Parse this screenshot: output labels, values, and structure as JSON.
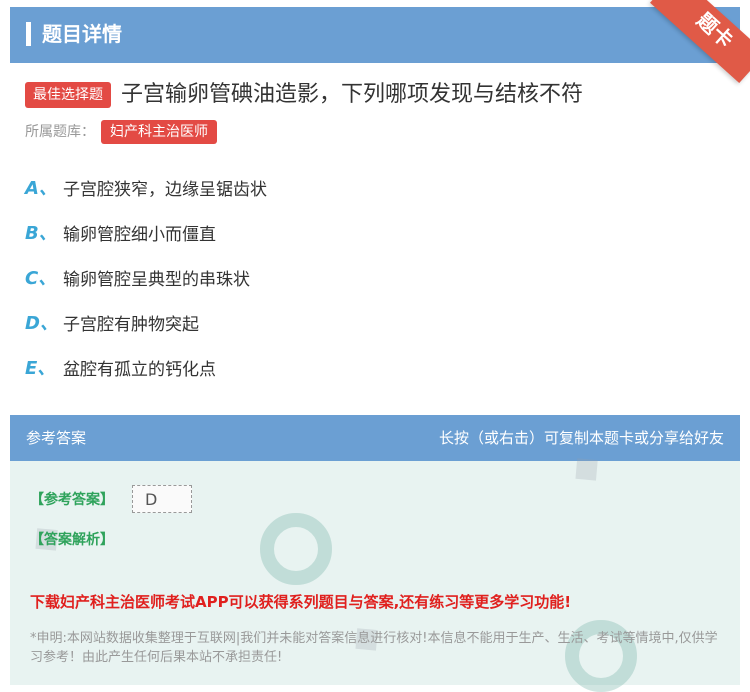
{
  "header": {
    "title": "题目详情"
  },
  "ribbon": {
    "label": "题卡",
    "color": "#e05a47"
  },
  "question": {
    "badge": "最佳选择题",
    "text": "子宫输卵管碘油造影，下列哪项发现与结核不符",
    "bank_label": "所属题库：",
    "bank_tag": "妇产科主治医师"
  },
  "options": [
    {
      "letter": "A、",
      "text": "子宫腔狭窄，边缘呈锯齿状"
    },
    {
      "letter": "B、",
      "text": "输卵管腔细小而僵直"
    },
    {
      "letter": "C、",
      "text": "输卵管腔呈典型的串珠状"
    },
    {
      "letter": "D、",
      "text": "子宫腔有肿物突起"
    },
    {
      "letter": "E、",
      "text": "盆腔有孤立的钙化点"
    }
  ],
  "answer": {
    "header_left": "参考答案",
    "header_right": "长按（或右击）可复制本题卡或分享给好友",
    "answer_label": "【参考答案】",
    "answer_value": "D",
    "analysis_label": "【答案解析】",
    "promo": "下载妇产科主治医师考试APP可以获得系列题目与答案,还有练习等更多学习功能!",
    "disclaimer": "*申明:本网站数据收集整理于互联网|我们并未能对答案信息进行核对!本信息不能用于生产、生活、考试等情境中,仅供学习参考！由此产生任何后果本站不承担责任!"
  },
  "colors": {
    "accent": "#6b9fd3",
    "badge": "#e34a44",
    "option_letter": "#3aa6d6",
    "answer_green": "#2fa35c",
    "promo_red": "#e0201e"
  }
}
